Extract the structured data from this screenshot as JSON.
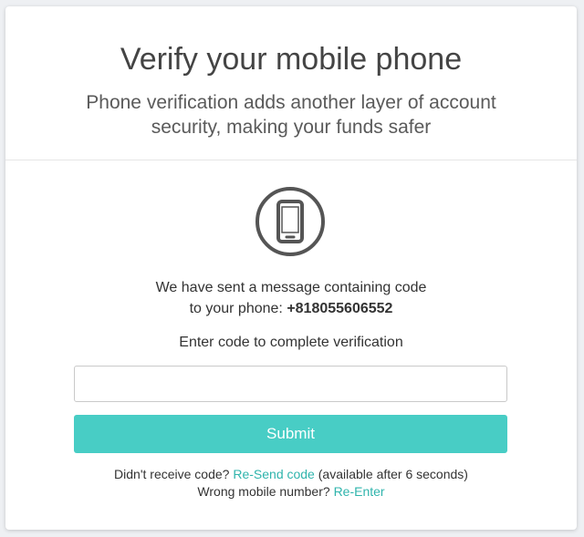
{
  "header": {
    "title": "Verify your mobile phone",
    "subtitle": "Phone verification adds another layer of account security, making your funds safer"
  },
  "icon": {
    "name": "mobile-phone-icon",
    "color": "#555555"
  },
  "message": {
    "line1": "We have sent a message containing code",
    "line2_prefix": "to your phone: ",
    "phone_number": "+818055606552"
  },
  "form": {
    "label": "Enter code to complete verification",
    "code_value": "",
    "submit_label": "Submit",
    "accent_color": "#48cdc5"
  },
  "footer": {
    "resend_prefix": "Didn't receive code?",
    "resend_link": "Re-Send code",
    "resend_suffix": "(available after 6 seconds)",
    "wrong_prefix": "Wrong mobile number?",
    "reenter_link": "Re-Enter"
  }
}
